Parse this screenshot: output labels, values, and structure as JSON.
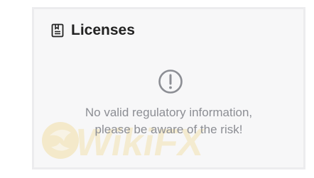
{
  "section": {
    "title": "Licenses",
    "title_icon": "license-document-icon"
  },
  "empty_state": {
    "icon": "exclamation-circle-icon",
    "message_line1": "No valid regulatory information,",
    "message_line2": "please be aware of the risk!"
  },
  "watermark": {
    "text": "WikiFX",
    "icon": "wikifx-logo-icon"
  },
  "colors": {
    "card_background": "#f7f7f8",
    "card_border": "#ececee",
    "title": "#222222",
    "message": "#8c8e94",
    "icon": "#8c8e94",
    "watermark": "#f3e2b0"
  }
}
